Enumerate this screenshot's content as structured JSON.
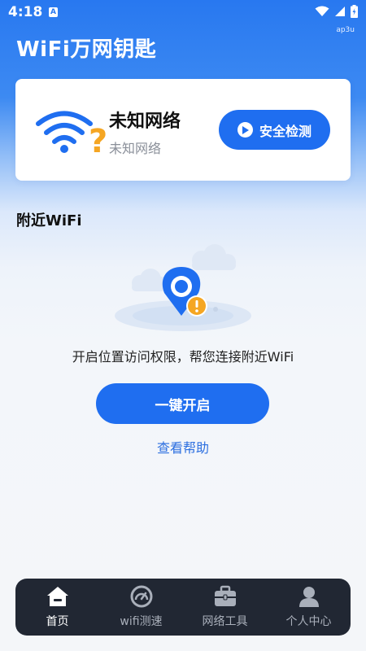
{
  "status_bar": {
    "time": "4:18",
    "badge": "A",
    "watermark": "ap3u",
    "icons": [
      "wifi-icon",
      "signal-icon",
      "battery-icon"
    ]
  },
  "app": {
    "title": "WiFi万网钥匙"
  },
  "network_card": {
    "name": "未知网络",
    "subtitle": "未知网络",
    "check_button_label": "安全检测"
  },
  "nearby": {
    "section_title": "附近WiFi",
    "permission_text": "开启位置访问权限，帮您连接附近WiFi",
    "enable_button_label": "一键开启",
    "help_link_label": "查看帮助"
  },
  "bottom_nav": {
    "items": [
      {
        "label": "首页",
        "icon": "home-icon",
        "active": true
      },
      {
        "label": "wifi测速",
        "icon": "speedometer-icon",
        "active": false
      },
      {
        "label": "网络工具",
        "icon": "toolbox-icon",
        "active": false
      },
      {
        "label": "个人中心",
        "icon": "person-icon",
        "active": false
      }
    ]
  },
  "colors": {
    "accent": "#1f6ef0",
    "header_blue": "#2878f0",
    "nav_background": "#212733",
    "warning_orange": "#f5a623"
  }
}
